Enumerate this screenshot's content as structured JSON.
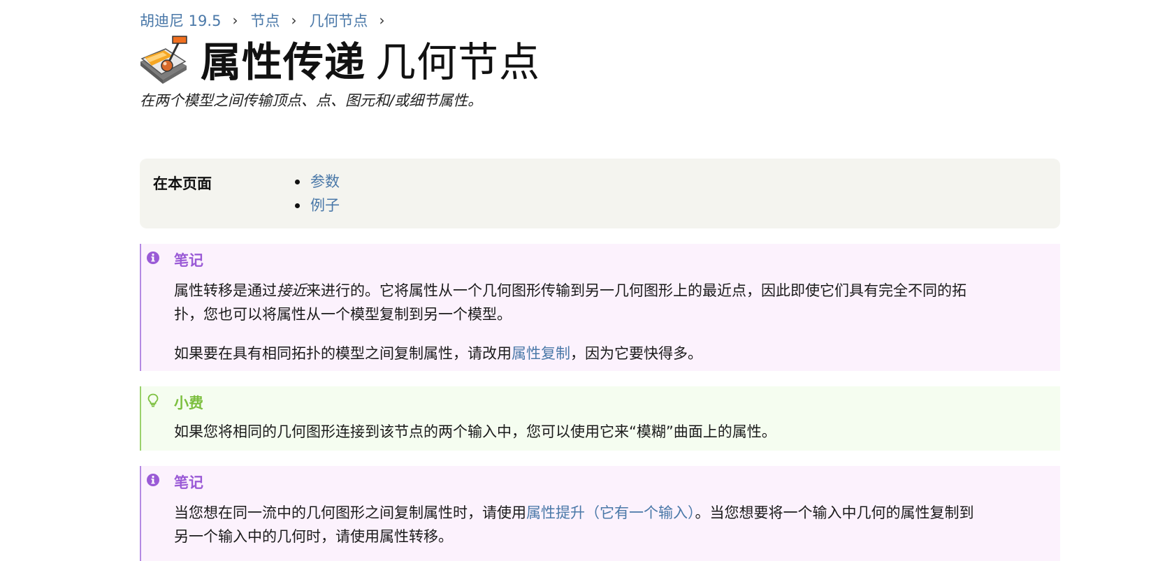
{
  "breadcrumb": {
    "items": [
      "胡迪尼 19.5",
      "节点",
      "几何节点"
    ]
  },
  "header": {
    "title_bold": "属性传递",
    "title_light": "几何节点",
    "summary": "在两个模型之间传输顶点、点、图元和/或细节属性。",
    "icon": "attribute-transfer-node-icon"
  },
  "toc": {
    "label": "在本页面",
    "items": [
      "参数",
      "例子"
    ]
  },
  "callouts": [
    {
      "type": "note",
      "icon": "info-icon",
      "title": "笔记",
      "p1_a": "属性转移是通过",
      "p1_em": "接近",
      "p1_b": "来进行的。它将属性从一个几何图形传输到另一几何图形上的最近点，因此即使它们具有完全不同的拓",
      "p1_c": "扑，您也可以将属性从一个模型复制到另一个模型。",
      "p2_a": "如果要在具有相同拓扑的模型之间复制属性，请改用",
      "p2_link": "属性复制",
      "p2_b": "，因为它要快得多。",
      "accent_color": "#9a5ad6"
    },
    {
      "type": "tip",
      "icon": "lightbulb-icon",
      "title": "小费",
      "p1": "如果您将相同的几何图形连接到该节点的两个输入中，您可以使用它来“模糊”曲面上的属性。",
      "accent_color": "#7cbf3f"
    },
    {
      "type": "note",
      "icon": "info-icon",
      "title": "笔记",
      "p1_a": "当您想在同一流中的几何图形之间复制属性时，请使用",
      "p1_link": "属性提升（它有一个输入）",
      "p1_b": "。当您想要将一个输入中几何的属性复制到",
      "p1_c": "另一个输入中的几何时，请使用属性转移。",
      "accent_color": "#9a5ad6"
    }
  ]
}
